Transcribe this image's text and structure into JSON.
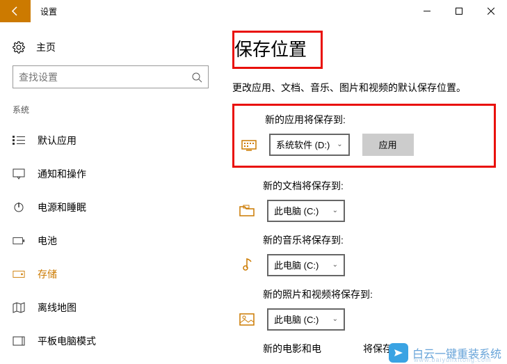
{
  "window": {
    "title": "设置"
  },
  "sidebar": {
    "home": "主页",
    "search_placeholder": "查找设置",
    "section": "系统",
    "items": [
      {
        "label": "默认应用"
      },
      {
        "label": "通知和操作"
      },
      {
        "label": "电源和睡眠"
      },
      {
        "label": "电池"
      },
      {
        "label": "存储"
      },
      {
        "label": "离线地图"
      },
      {
        "label": "平板电脑模式"
      }
    ]
  },
  "main": {
    "title": "保存位置",
    "description": "更改应用、文档、音乐、图片和视频的默认保存位置。",
    "apply": "应用",
    "settings": [
      {
        "label": "新的应用将保存到:",
        "value": "系统软件 (D:)"
      },
      {
        "label": "新的文档将保存到:",
        "value": "此电脑 (C:)"
      },
      {
        "label": "新的音乐将保存到:",
        "value": "此电脑 (C:)"
      },
      {
        "label": "新的照片和视频将保存到:",
        "value": "此电脑 (C:)"
      },
      {
        "label": "新的电影和电",
        "value_suffix": "将保存到:"
      }
    ]
  },
  "watermark": {
    "text": "白云一键重装系统",
    "url": "www.baiyunxitong.com"
  }
}
